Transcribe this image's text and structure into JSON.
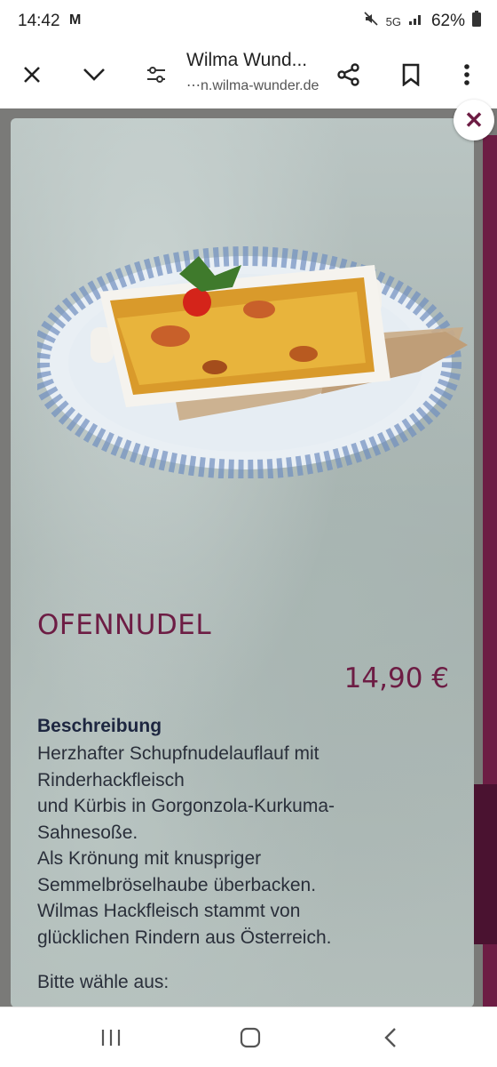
{
  "status": {
    "time": "14:42",
    "mail_icon": "M",
    "network": "5G",
    "battery": "62%"
  },
  "toolbar": {
    "title": "Wilma Wund...",
    "url": "⋯n.wilma-wunder.de"
  },
  "dish": {
    "name": "OFENNUDEL",
    "price": "14,90 €",
    "description_heading": "Beschreibung",
    "description_lines": [
      "Herzhafter Schupfnudelauflauf mit",
      "Rinderhackfleisch",
      "und Kürbis in Gorgonzola-Kurkuma-",
      "Sahnesoße.",
      "Als Krönung mit knuspriger",
      "Semmelbröselhaube überbacken.",
      "Wilmas Hackfleisch stammt von",
      "glücklichen Rindern aus Österreich."
    ],
    "choose_label": "Bitte wähle aus:"
  },
  "colors": {
    "brand": "#6d1d44",
    "heading": "#1d2640"
  }
}
